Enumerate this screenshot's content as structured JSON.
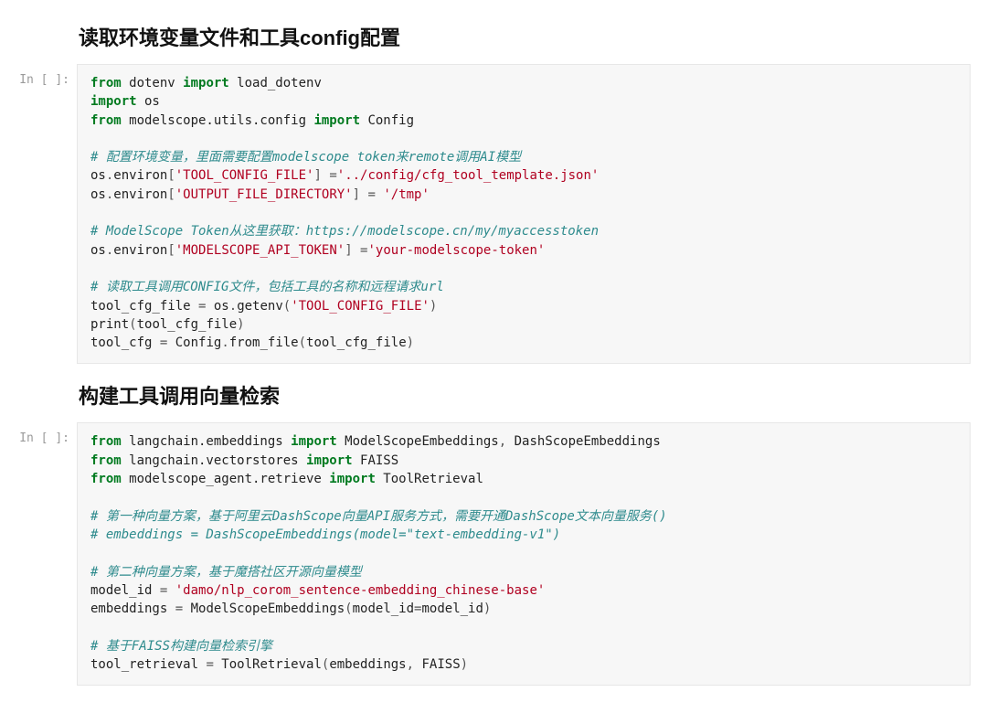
{
  "headings": {
    "h1": "读取环境变量文件和工具config配置",
    "h2": "构建工具调用向量检索"
  },
  "prompts": {
    "cell1": "In [ ]:",
    "cell2": "In [ ]:"
  },
  "cell1": {
    "tokens": [
      [
        "kw",
        "from"
      ],
      [
        "nm",
        " dotenv "
      ],
      [
        "kw",
        "import"
      ],
      [
        "nm",
        " load_dotenv"
      ],
      [
        "nl",
        ""
      ],
      [
        "kw",
        "import"
      ],
      [
        "nm",
        " os"
      ],
      [
        "nl",
        ""
      ],
      [
        "kw",
        "from"
      ],
      [
        "nm",
        " modelscope.utils.config "
      ],
      [
        "kw",
        "import"
      ],
      [
        "nm",
        " Config"
      ],
      [
        "nl",
        ""
      ],
      [
        "nl",
        ""
      ],
      [
        "com",
        "# 配置环境变量，里面需要配置modelscope token来remote调用AI模型"
      ],
      [
        "nl",
        ""
      ],
      [
        "nm",
        "os"
      ],
      [
        "op",
        "."
      ],
      [
        "nm",
        "environ"
      ],
      [
        "op",
        "["
      ],
      [
        "str",
        "'TOOL_CONFIG_FILE'"
      ],
      [
        "op",
        "] ="
      ],
      [
        "str",
        "'../config/cfg_tool_template.json'"
      ],
      [
        "nl",
        ""
      ],
      [
        "nm",
        "os"
      ],
      [
        "op",
        "."
      ],
      [
        "nm",
        "environ"
      ],
      [
        "op",
        "["
      ],
      [
        "str",
        "'OUTPUT_FILE_DIRECTORY'"
      ],
      [
        "op",
        "] = "
      ],
      [
        "str",
        "'/tmp'"
      ],
      [
        "nl",
        ""
      ],
      [
        "nl",
        ""
      ],
      [
        "com",
        "# ModelScope Token从这里获取：https://modelscope.cn/my/myaccesstoken"
      ],
      [
        "nl",
        ""
      ],
      [
        "nm",
        "os"
      ],
      [
        "op",
        "."
      ],
      [
        "nm",
        "environ"
      ],
      [
        "op",
        "["
      ],
      [
        "str",
        "'MODELSCOPE_API_TOKEN'"
      ],
      [
        "op",
        "] ="
      ],
      [
        "str",
        "'your-modelscope-token'"
      ],
      [
        "nl",
        ""
      ],
      [
        "nl",
        ""
      ],
      [
        "com",
        "# 读取工具调用CONFIG文件，包括工具的名称和远程请求url"
      ],
      [
        "nl",
        ""
      ],
      [
        "nm",
        "tool_cfg_file "
      ],
      [
        "op",
        "="
      ],
      [
        "nm",
        " os"
      ],
      [
        "op",
        "."
      ],
      [
        "fn",
        "getenv"
      ],
      [
        "op",
        "("
      ],
      [
        "str",
        "'TOOL_CONFIG_FILE'"
      ],
      [
        "op",
        ")"
      ],
      [
        "nl",
        ""
      ],
      [
        "fn",
        "print"
      ],
      [
        "op",
        "("
      ],
      [
        "nm",
        "tool_cfg_file"
      ],
      [
        "op",
        ")"
      ],
      [
        "nl",
        ""
      ],
      [
        "nm",
        "tool_cfg "
      ],
      [
        "op",
        "="
      ],
      [
        "nm",
        " Config"
      ],
      [
        "op",
        "."
      ],
      [
        "fn",
        "from_file"
      ],
      [
        "op",
        "("
      ],
      [
        "nm",
        "tool_cfg_file"
      ],
      [
        "op",
        ")"
      ]
    ]
  },
  "cell2": {
    "tokens": [
      [
        "kw",
        "from"
      ],
      [
        "nm",
        " langchain.embeddings "
      ],
      [
        "kw",
        "import"
      ],
      [
        "nm",
        " ModelScopeEmbeddings"
      ],
      [
        "op",
        ", "
      ],
      [
        "nm",
        "DashScopeEmbeddings"
      ],
      [
        "nl",
        ""
      ],
      [
        "kw",
        "from"
      ],
      [
        "nm",
        " langchain.vectorstores "
      ],
      [
        "kw",
        "import"
      ],
      [
        "nm",
        " FAISS"
      ],
      [
        "nl",
        ""
      ],
      [
        "kw",
        "from"
      ],
      [
        "nm",
        " modelscope_agent.retrieve "
      ],
      [
        "kw",
        "import"
      ],
      [
        "nm",
        " ToolRetrieval"
      ],
      [
        "nl",
        ""
      ],
      [
        "nl",
        ""
      ],
      [
        "com",
        "# 第一种向量方案，基于阿里云DashScope向量API服务方式，需要开通DashScope文本向量服务()"
      ],
      [
        "nl",
        ""
      ],
      [
        "com",
        "# embeddings = DashScopeEmbeddings(model=\"text-embedding-v1\")"
      ],
      [
        "nl",
        ""
      ],
      [
        "nl",
        ""
      ],
      [
        "com",
        "# 第二种向量方案，基于魔搭社区开源向量模型"
      ],
      [
        "nl",
        ""
      ],
      [
        "nm",
        "model_id "
      ],
      [
        "op",
        "="
      ],
      [
        "nm",
        " "
      ],
      [
        "str",
        "'damo/nlp_corom_sentence-embedding_chinese-base'"
      ],
      [
        "nl",
        ""
      ],
      [
        "nm",
        "embeddings "
      ],
      [
        "op",
        "="
      ],
      [
        "nm",
        " ModelScopeEmbeddings"
      ],
      [
        "op",
        "("
      ],
      [
        "nm",
        "model_id"
      ],
      [
        "op",
        "="
      ],
      [
        "nm",
        "model_id"
      ],
      [
        "op",
        ")"
      ],
      [
        "nl",
        ""
      ],
      [
        "nl",
        ""
      ],
      [
        "com",
        "# 基于FAISS构建向量检索引擎"
      ],
      [
        "nl",
        ""
      ],
      [
        "nm",
        "tool_retrieval "
      ],
      [
        "op",
        "="
      ],
      [
        "nm",
        " ToolRetrieval"
      ],
      [
        "op",
        "("
      ],
      [
        "nm",
        "embeddings"
      ],
      [
        "op",
        ", "
      ],
      [
        "nm",
        "FAISS"
      ],
      [
        "op",
        ")"
      ]
    ]
  }
}
